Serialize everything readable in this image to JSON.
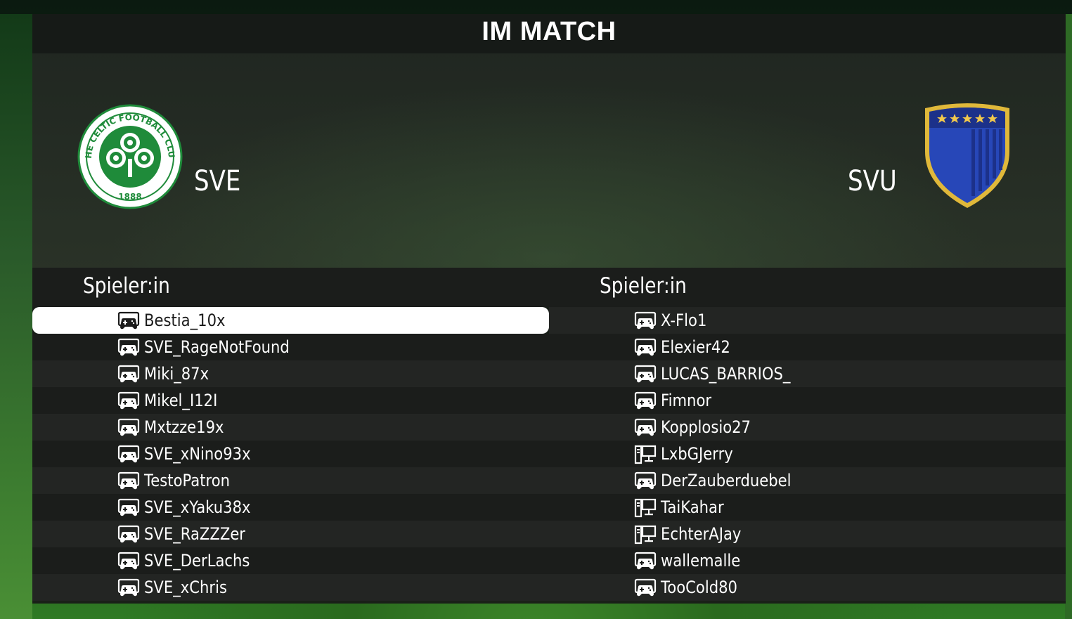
{
  "title": "IM MATCH",
  "teams": {
    "left": {
      "name": "SVE",
      "crest": "celtic-crest-icon",
      "crest_text": "THE CELTIC FOOTBALL CLUB",
      "crest_year": "1888"
    },
    "right": {
      "name": "SVU",
      "crest": "blue-shield-crest-icon"
    }
  },
  "column_header": "Spieler:in",
  "players_left": [
    {
      "name": "Bestia_10x",
      "platform": "console",
      "selected": true
    },
    {
      "name": "SVE_RageNotFound",
      "platform": "console"
    },
    {
      "name": "Miki_87x",
      "platform": "console"
    },
    {
      "name": "Mikel_I12I",
      "platform": "console"
    },
    {
      "name": "Mxtzze19x",
      "platform": "console"
    },
    {
      "name": "SVE_xNino93x",
      "platform": "console"
    },
    {
      "name": "TestoPatron",
      "platform": "console"
    },
    {
      "name": "SVE_xYaku38x",
      "platform": "console"
    },
    {
      "name": "SVE_RaZZZer",
      "platform": "console"
    },
    {
      "name": "SVE_DerLachs",
      "platform": "console"
    },
    {
      "name": "SVE_xChris",
      "platform": "console"
    }
  ],
  "players_right": [
    {
      "name": "X-Flo1",
      "platform": "console"
    },
    {
      "name": "Elexier42",
      "platform": "console"
    },
    {
      "name": "LUCAS_BARRIOS_",
      "platform": "console"
    },
    {
      "name": "Fimnor",
      "platform": "console"
    },
    {
      "name": "Kopplosio27",
      "platform": "console"
    },
    {
      "name": "LxbGJerry",
      "platform": "pc"
    },
    {
      "name": "DerZauberduebel",
      "platform": "console"
    },
    {
      "name": "TaiKahar",
      "platform": "pc"
    },
    {
      "name": "EchterAJay",
      "platform": "pc"
    },
    {
      "name": "wallemalle",
      "platform": "console"
    },
    {
      "name": "TooCold80",
      "platform": "console"
    }
  ],
  "colors": {
    "celtic_green": "#1f8b3a",
    "shield_blue": "#2747b8",
    "shield_gold": "#e0b83a"
  }
}
